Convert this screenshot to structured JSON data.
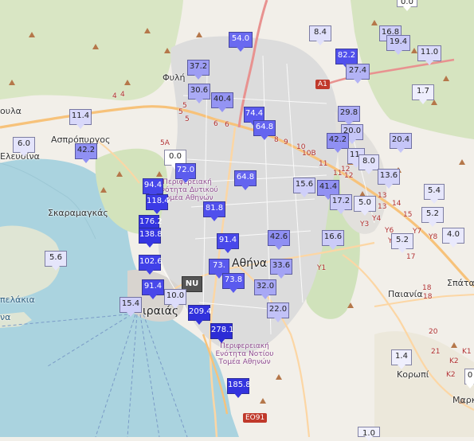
{
  "map": {
    "places": [
      {
        "id": "fyli",
        "text": "Φυλή"
      },
      {
        "id": "aspropyrgos",
        "text": "Ασπρόπυργος"
      },
      {
        "id": "elefsina",
        "text": "Ελευσίνα"
      },
      {
        "id": "magoula",
        "text": "ουλα"
      },
      {
        "id": "skaramangas",
        "text": "Σκαραμαγκάς"
      },
      {
        "id": "athina",
        "text": "Αθήνα"
      },
      {
        "id": "peiraias",
        "text": "ιραιάς"
      },
      {
        "id": "paiania",
        "text": "Παιανία"
      },
      {
        "id": "spata",
        "text": "Σπάτα"
      },
      {
        "id": "koropi",
        "text": "Κορωπί"
      },
      {
        "id": "markopoulo",
        "text": "Μαρκ"
      },
      {
        "id": "elakia",
        "text": "πελάκια"
      },
      {
        "id": "sea-a",
        "text": "να"
      },
      {
        "id": "admin-west",
        "text": "Περιφερειακή Ενότητα Δυτικού Τομέα Αθηνών"
      },
      {
        "id": "admin-south",
        "text": "Περιφερειακή Ενότητα Νοτίου Τομέα Αθηνών"
      }
    ],
    "road_shields": [
      "A1",
      "EO91"
    ],
    "road_labels": [
      "4",
      "4",
      "5",
      "5",
      "5",
      "6",
      "6",
      "5A",
      "8",
      "9",
      "10",
      "10B",
      "11",
      "11",
      "12",
      "12",
      "13",
      "13",
      "14",
      "15",
      "Y1",
      "Y3",
      "Y4",
      "Y6",
      "Y7",
      "Y8",
      "Y7E",
      "17",
      "18",
      "18",
      "20",
      "21",
      "K1",
      "K2",
      "K2"
    ],
    "nu_badge": "NU"
  },
  "markers": [
    {
      "value": "0.0",
      "color": "#ffffff"
    },
    {
      "value": "54.0",
      "color": "#6a6af0"
    },
    {
      "value": "8.4",
      "color": "#e0e0fb"
    },
    {
      "value": "16.8",
      "color": "#cfcff9"
    },
    {
      "value": "19.4",
      "color": "#c9c9f8"
    },
    {
      "value": "11.0",
      "color": "#dadafa"
    },
    {
      "value": "82.2",
      "color": "#5050ec"
    },
    {
      "value": "27.4",
      "color": "#b3b3f5"
    },
    {
      "value": "37.2",
      "color": "#9d9df4"
    },
    {
      "value": "30.6",
      "color": "#aaaaf5"
    },
    {
      "value": "40.4",
      "color": "#9494f3"
    },
    {
      "value": "1.7",
      "color": "#eeeefd"
    },
    {
      "value": "11.4",
      "color": "#d8d8fa"
    },
    {
      "value": "74.4",
      "color": "#5a5aee"
    },
    {
      "value": "64.8",
      "color": "#6464ef"
    },
    {
      "value": "29.8",
      "color": "#adadf5"
    },
    {
      "value": "20.0",
      "color": "#c6c6f8"
    },
    {
      "value": "6.0",
      "color": "#e4e4fb"
    },
    {
      "value": "42.2",
      "color": "#9090f3"
    },
    {
      "value": "42.2",
      "color": "#9090f3"
    },
    {
      "value": "11.",
      "color": "#d8d8fa"
    },
    {
      "value": "20.4",
      "color": "#c5c5f8"
    },
    {
      "value": "0.0",
      "color": "#ffffff"
    },
    {
      "value": "8.0",
      "color": "#e1e1fb"
    },
    {
      "value": "72.0",
      "color": "#5c5cee"
    },
    {
      "value": "13.6",
      "color": "#d3d3f9"
    },
    {
      "value": "64.8",
      "color": "#6464ef"
    },
    {
      "value": "15.6",
      "color": "#cfcff9"
    },
    {
      "value": "41.4",
      "color": "#9191f3"
    },
    {
      "value": "94.4",
      "color": "#4646ea"
    },
    {
      "value": "5.4",
      "color": "#e6e6fb"
    },
    {
      "value": "17.2",
      "color": "#cacaf8"
    },
    {
      "value": "5.0",
      "color": "#e7e7fc"
    },
    {
      "value": "118.4",
      "color": "#3b3be6"
    },
    {
      "value": "81.8",
      "color": "#5050ec"
    },
    {
      "value": "5.2",
      "color": "#e6e6fb"
    },
    {
      "value": "176.2",
      "color": "#3434e0"
    },
    {
      "value": "138.8",
      "color": "#3636e2"
    },
    {
      "value": "4.0",
      "color": "#e9e9fc"
    },
    {
      "value": "42.6",
      "color": "#8f8ff3"
    },
    {
      "value": "16.6",
      "color": "#cbcbf8"
    },
    {
      "value": "5.2",
      "color": "#e6e6fb"
    },
    {
      "value": "91.4",
      "color": "#4848ea"
    },
    {
      "value": "5.6",
      "color": "#e5e5fb"
    },
    {
      "value": "102.6",
      "color": "#4040e8"
    },
    {
      "value": "73.",
      "color": "#5a5aee"
    },
    {
      "value": "33.6",
      "color": "#a3a3f4"
    },
    {
      "value": "73.8",
      "color": "#5a5aee"
    },
    {
      "value": "91.4",
      "color": "#4848ea"
    },
    {
      "value": "32.0",
      "color": "#a8a8f5"
    },
    {
      "value": "10.0",
      "color": "#dcdcfa"
    },
    {
      "value": "15.4",
      "color": "#cfcff9"
    },
    {
      "value": "209.4",
      "color": "#3131dc"
    },
    {
      "value": "22.0",
      "color": "#c2c2f7"
    },
    {
      "value": "278.1",
      "color": "#2c2cd6"
    },
    {
      "value": "1.4",
      "color": "#efeffd"
    },
    {
      "value": "185.8",
      "color": "#3333de"
    },
    {
      "value": "0",
      "color": "#ffffff"
    },
    {
      "value": "1.0",
      "color": "#f0f0fd"
    }
  ]
}
